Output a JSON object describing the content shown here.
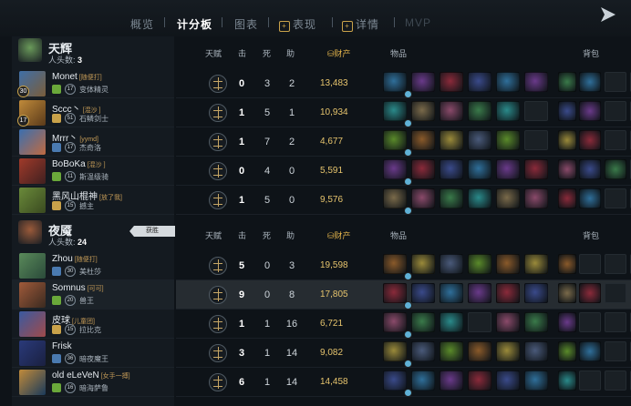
{
  "nav": {
    "tabs": [
      "概览",
      "计分板",
      "图表",
      "表现",
      "详情",
      "MVP"
    ],
    "active_tab": "计分板"
  },
  "columns": {
    "talent": "天赋",
    "kills": "击",
    "deaths": "死",
    "assists": "助",
    "networth": "财产",
    "items": "物品",
    "backpack": "背包"
  },
  "teams": [
    {
      "name": "天辉",
      "kills_label": "人头数:",
      "kills": "3",
      "color": "#6a9a5a",
      "players": [
        {
          "name": "Monet",
          "tag": "[随便打]",
          "level": "30",
          "rank": "17",
          "title": "变体精灵",
          "k": "0",
          "d": "3",
          "a": "2",
          "networth": "13,483"
        },
        {
          "name": "Sccc丶",
          "tag": "[混沙 ]",
          "level": "17",
          "rank": "51",
          "title": "石鳞剑士",
          "k": "1",
          "d": "5",
          "a": "1",
          "networth": "10,934"
        },
        {
          "name": "Mrrr丶",
          "tag": "[yymd]",
          "level": "",
          "rank": "17",
          "title": "杰奇洛",
          "k": "1",
          "d": "7",
          "a": "2",
          "networth": "4,677"
        },
        {
          "name": "BoBoKa",
          "tag": "[混沙 ]",
          "level": "",
          "rank": "11",
          "title": "斯温级骑",
          "k": "0",
          "d": "4",
          "a": "0",
          "networth": "5,591"
        },
        {
          "name": "黑风山棍神",
          "tag": "[放了我]",
          "level": "",
          "rank": "15",
          "title": "撼主",
          "k": "1",
          "d": "5",
          "a": "0",
          "networth": "9,576"
        }
      ]
    },
    {
      "name": "夜魇",
      "kills_label": "人头数:",
      "kills": "24",
      "color": "#9a5a3a",
      "players": [
        {
          "name": "Zhou",
          "tag": "[随便打]",
          "level": "",
          "rank": "30",
          "title": "美杜莎",
          "k": "5",
          "d": "0",
          "a": "3",
          "networth": "19,598"
        },
        {
          "name": "Somnus",
          "tag": "[可可]",
          "level": "",
          "rank": "20",
          "title": "兽王",
          "k": "9",
          "d": "0",
          "a": "8",
          "networth": "17,805"
        },
        {
          "name": "皮球",
          "tag": "[儿童团]",
          "level": "",
          "rank": "15",
          "title": "拉比克",
          "k": "1",
          "d": "1",
          "a": "16",
          "networth": "6,721"
        },
        {
          "name": "Frisk",
          "tag": "",
          "level": "",
          "rank": "36",
          "title": "暗夜魔王",
          "k": "3",
          "d": "1",
          "a": "14",
          "networth": "9,082"
        },
        {
          "name": "old eLeVeN",
          "tag": "[女手一搏]",
          "level": "",
          "rank": "16",
          "title": "暗海萨鲁",
          "k": "6",
          "d": "1",
          "a": "14",
          "networth": "14,458"
        }
      ]
    }
  ],
  "cut_badge": "获胜"
}
